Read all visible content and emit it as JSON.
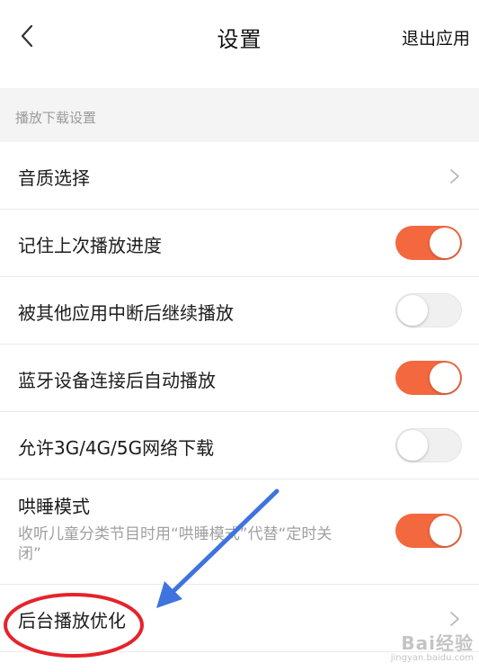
{
  "header": {
    "title": "设置",
    "exit_label": "退出应用",
    "back_icon": "chevron-left-icon"
  },
  "section": {
    "title": "播放下载设置"
  },
  "items": [
    {
      "label": "音质选择",
      "control": "chevron"
    },
    {
      "label": "记住上次播放进度",
      "control": "toggle",
      "on": true
    },
    {
      "label": "被其他应用中断后继续播放",
      "control": "toggle",
      "on": false
    },
    {
      "label": "蓝牙设备连接后自动播放",
      "control": "toggle",
      "on": true
    },
    {
      "label": "允许3G/4G/5G网络下载",
      "control": "toggle",
      "on": false
    },
    {
      "label": "哄睡模式",
      "description": "收听儿童分类节目时用“哄睡模式”代替“定时关闭”",
      "control": "toggle",
      "on": true
    },
    {
      "label": "后台播放优化",
      "control": "chevron"
    }
  ],
  "colors": {
    "accent": "#f3683f",
    "annotation_circle": "#e5232b",
    "annotation_arrow": "#3f73df"
  },
  "watermark": {
    "brand": "Bai经验",
    "url": "jingyan.baidu.com"
  }
}
